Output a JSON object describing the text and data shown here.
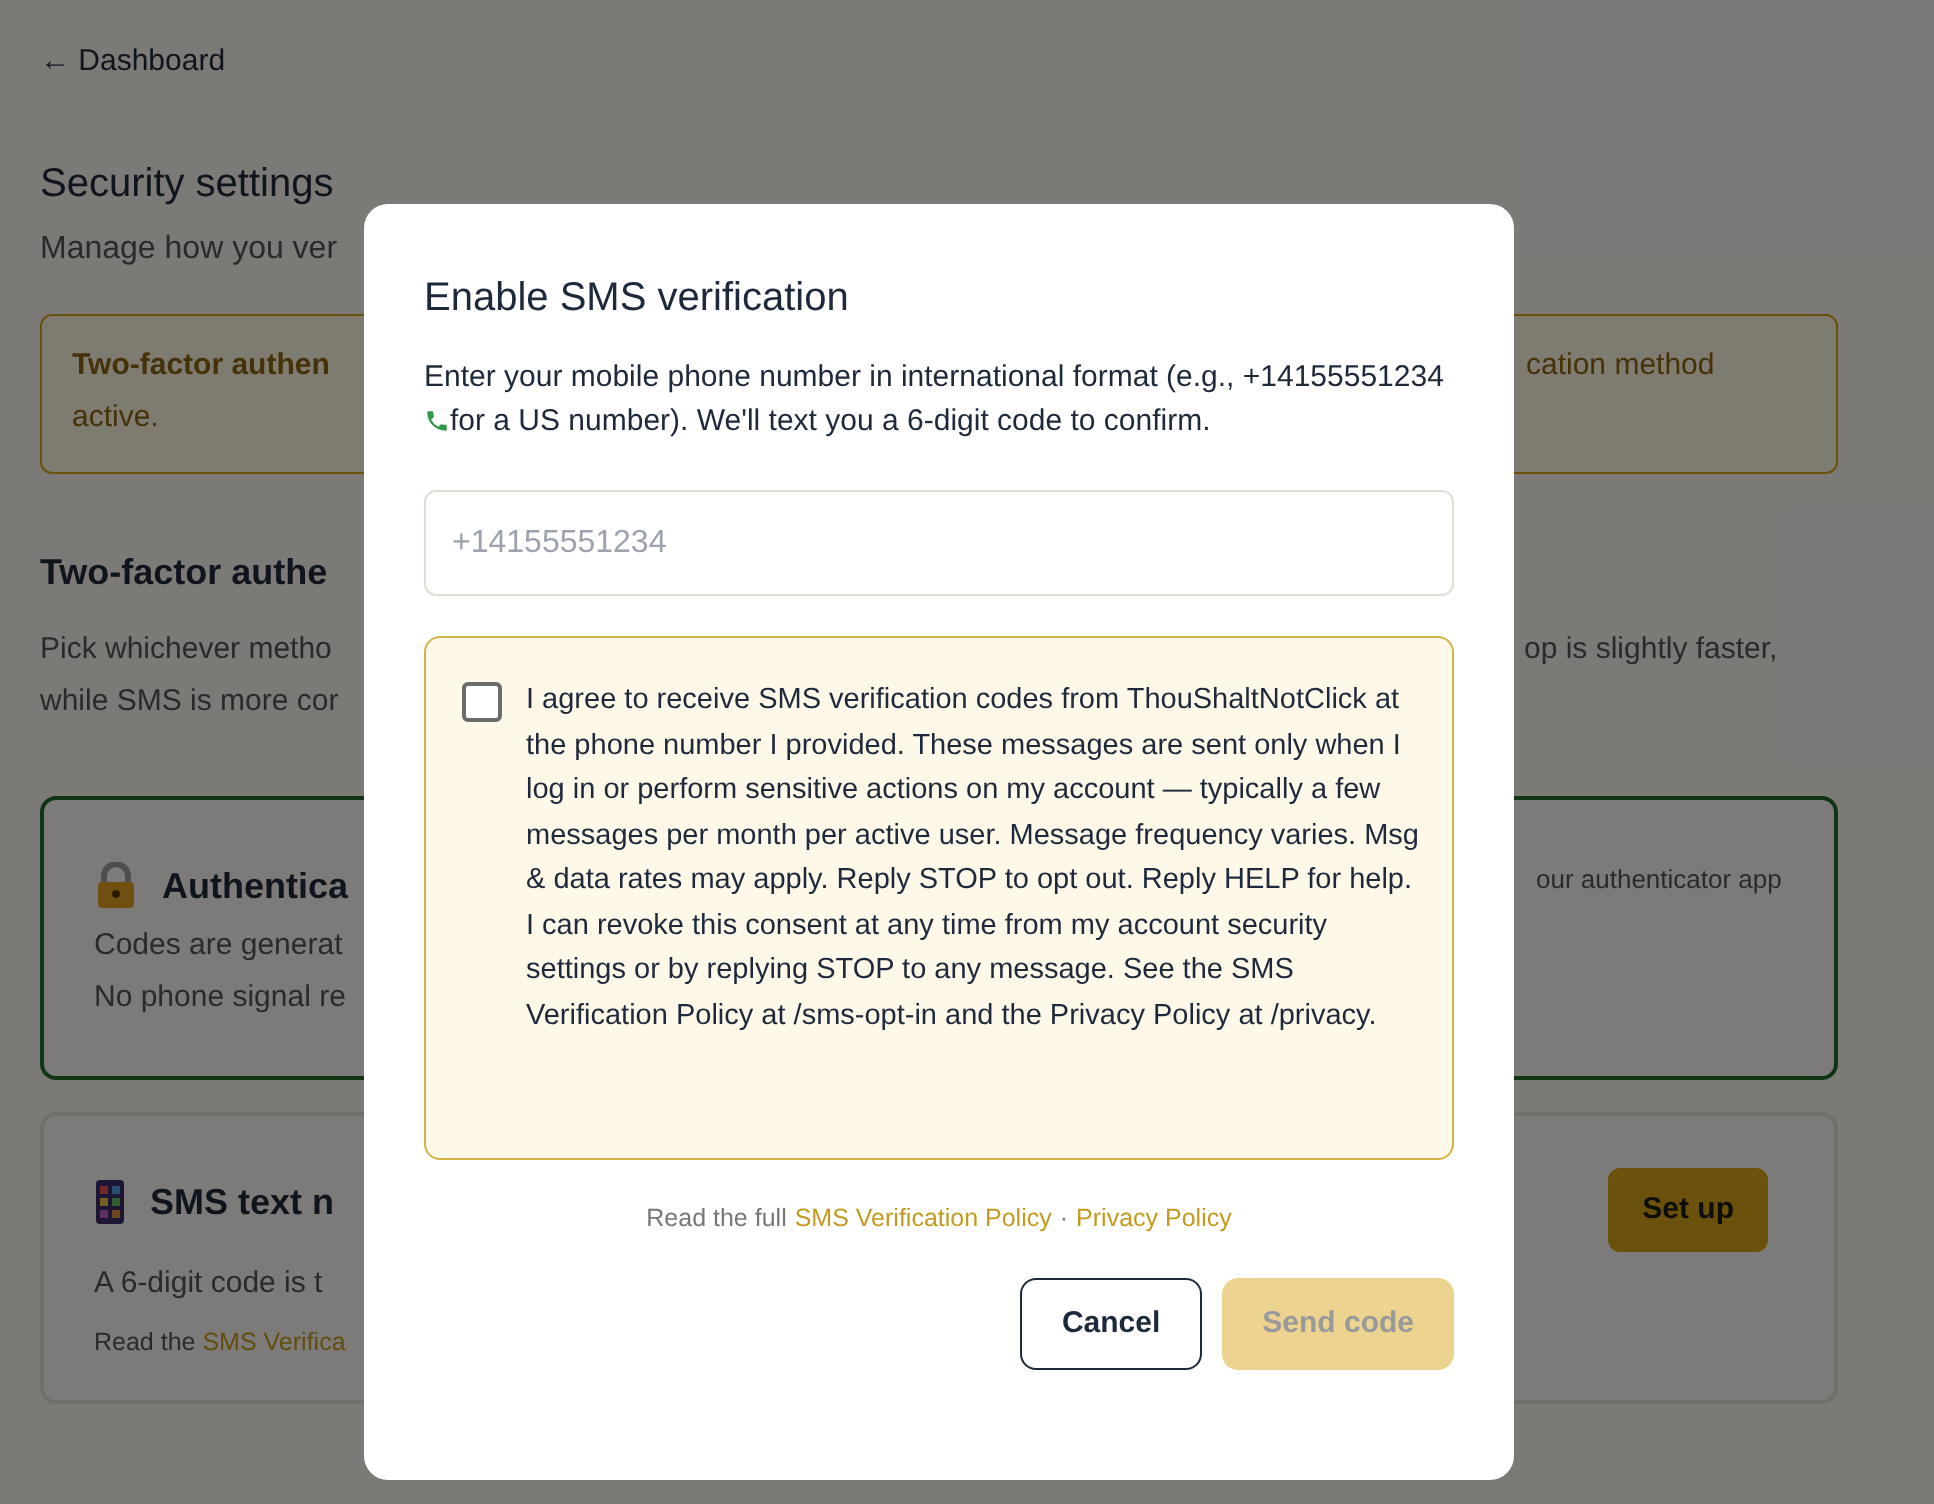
{
  "back_link": "← Dashboard",
  "page": {
    "title": "Security settings",
    "subtitle": "Manage how you ver",
    "alert": {
      "left": "Two-factor authen",
      "right": "cation method",
      "line2": "active."
    },
    "section": {
      "title": "Two-factor authe",
      "desc_left": [
        "Pick whichever metho",
        "while SMS is more cor"
      ],
      "desc_right": "op is slightly faster,"
    },
    "methods": [
      {
        "kind": "authenticator",
        "selected": true,
        "title": "Authentica",
        "lines": [
          "Codes are generat",
          "No phone signal re"
        ],
        "right_text": "our authenticator app"
      },
      {
        "kind": "sms",
        "selected": false,
        "title": "SMS text n",
        "lines": [
          "A 6-digit code is t"
        ],
        "footer_prefix": "Read the",
        "footer_link": "SMS Verifica",
        "button": "Set up"
      }
    ]
  },
  "dialog": {
    "title": "Enable SMS verification",
    "description_before": "Enter your mobile phone number in international format (e.g., +14155551234",
    "description_after": "for a US number). We'll text you a 6-digit code to confirm.",
    "phone_field": {
      "placeholder": "+14155551234"
    },
    "consent": {
      "checked": false,
      "text": "I agree to receive SMS verification codes from ThouShaltNotClick at the phone number I provided. These messages are sent only when I log in or perform sensitive actions on my account — typically a few messages per month per active user. Message frequency varies. Msg & data rates may apply. Reply STOP to opt out. Reply HELP for help. I can revoke this consent at any time from my account security settings or by replying STOP to any message. See the SMS Verification Policy at /sms-opt-in and the Privacy Policy at /privacy."
    },
    "footer": {
      "prefix": "Read the full",
      "links": [
        "SMS Verification Policy",
        "Privacy Policy"
      ],
      "separator": "·"
    },
    "buttons": [
      {
        "kind": "secondary",
        "label": "Cancel",
        "disabled": false
      },
      {
        "kind": "primary",
        "label": "Send code",
        "disabled": true
      }
    ]
  }
}
